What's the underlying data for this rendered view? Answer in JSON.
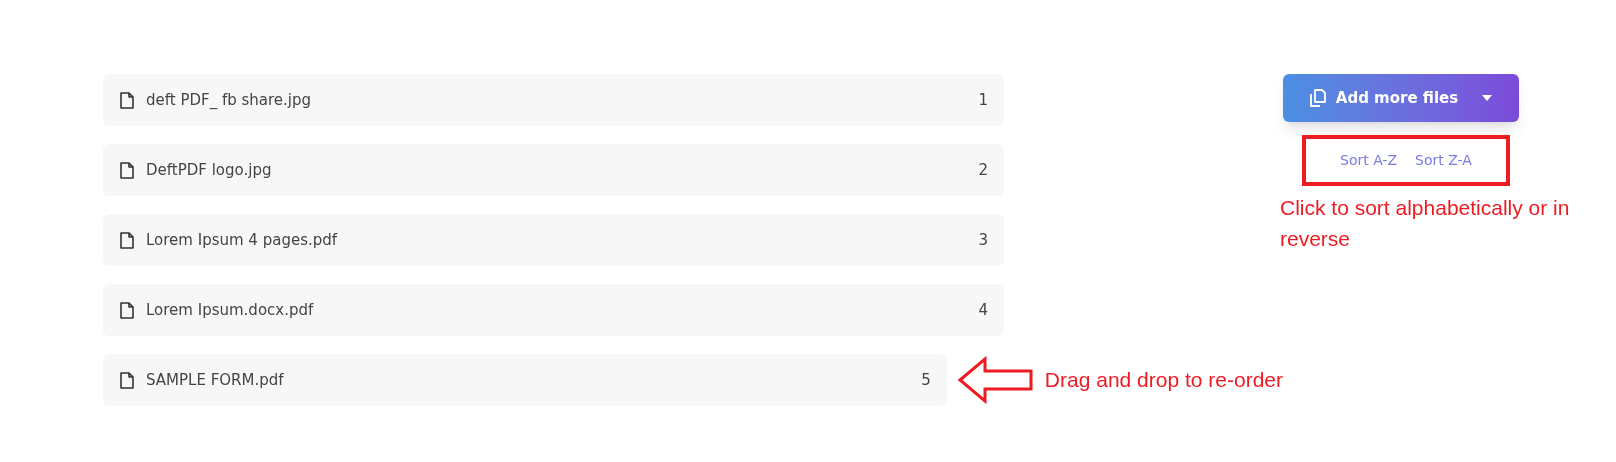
{
  "files": [
    {
      "name": "deft PDF_ fb share.jpg",
      "number": "1"
    },
    {
      "name": "DeftPDF logo.jpg",
      "number": "2"
    },
    {
      "name": "Lorem Ipsum 4 pages.pdf",
      "number": "3"
    },
    {
      "name": "Lorem Ipsum.docx.pdf",
      "number": "4"
    },
    {
      "name": "SAMPLE FORM.pdf",
      "number": "5"
    }
  ],
  "add_button": {
    "label": "Add more files"
  },
  "sort_links": [
    "Sort A-Z",
    "Sort Z-A"
  ],
  "annotations": [
    {
      "text": "Click to sort alphabetically or in reverse"
    },
    {
      "text": "Drag and drop to re-order"
    }
  ]
}
